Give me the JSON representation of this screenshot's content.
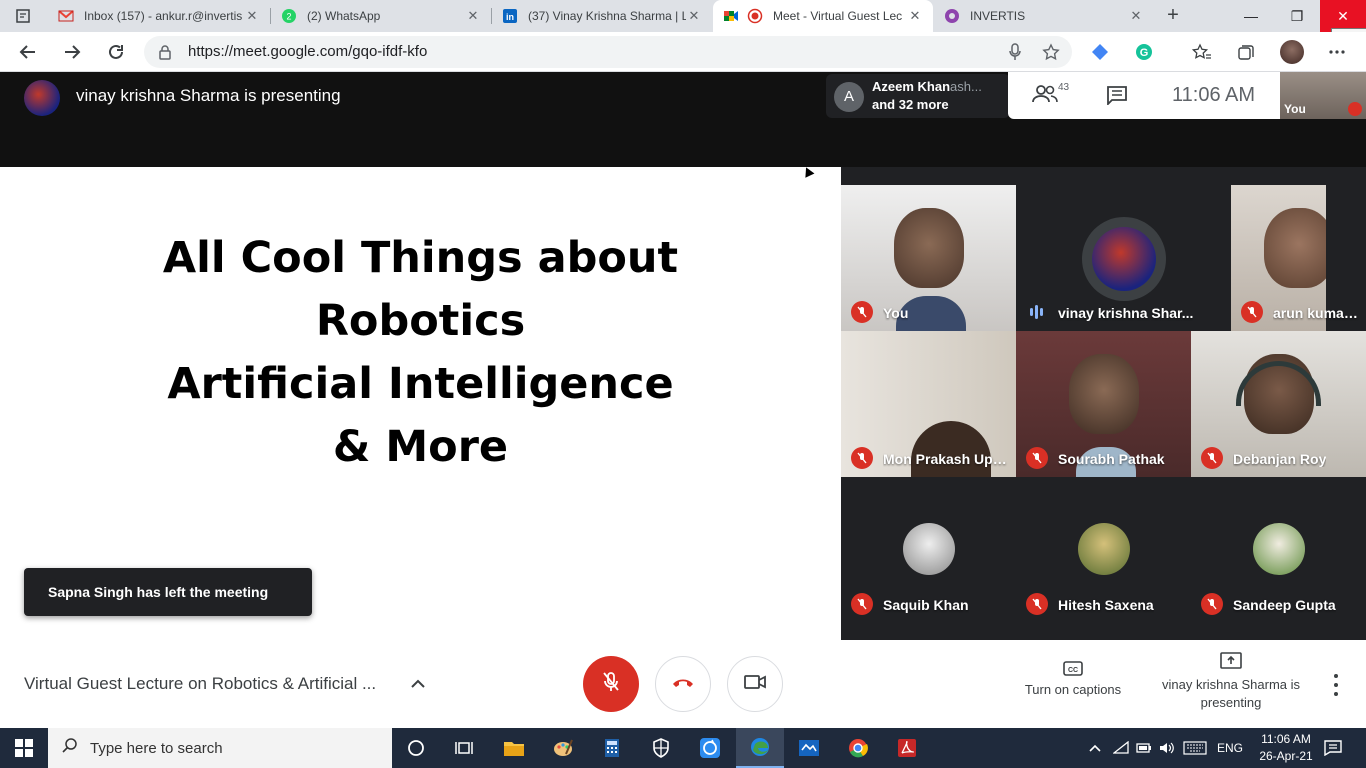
{
  "browser": {
    "tabs": [
      {
        "title": "Inbox (157) - ankur.r@invertis",
        "icon": "gmail-icon"
      },
      {
        "title": "(2) WhatsApp",
        "icon": "whatsapp-icon"
      },
      {
        "title": "(37) Vinay Krishna Sharma | Li",
        "icon": "linkedin-icon"
      },
      {
        "title": "Meet - Virtual Guest Lec",
        "icon": "meet-icon"
      },
      {
        "title": "INVERTIS",
        "icon": "invertis-icon"
      }
    ],
    "close_tooltip": "Close",
    "url": "https://meet.google.com/gqo-ifdf-kfo"
  },
  "meet": {
    "presenting_banner": "vinay krishna Sharma is presenting",
    "joiners": {
      "avatar_letter": "A",
      "line1": "Azeem Khan",
      "line1_faded": "ash...",
      "line2": "and 32 more"
    },
    "participant_count": "43",
    "clock": "11:06  AM",
    "self_label": "You",
    "slide": {
      "lines": [
        "All Cool Things about",
        "Robotics",
        "Artificial Intelligence",
        "& More"
      ]
    },
    "toast": "Sapna Singh has left the meeting",
    "participants": [
      {
        "name": "You",
        "muted": true
      },
      {
        "name": "vinay krishna Shar...",
        "muted": false
      },
      {
        "name": "arun kumar gang...",
        "muted": true
      },
      {
        "name": "Mon Prakash Upa...",
        "muted": true
      },
      {
        "name": "Sourabh Pathak",
        "muted": true
      },
      {
        "name": "Debanjan Roy",
        "muted": true
      },
      {
        "name": "Saquib Khan",
        "muted": true
      },
      {
        "name": "Hitesh Saxena",
        "muted": true
      },
      {
        "name": "Sandeep Gupta",
        "muted": true
      }
    ],
    "meeting_name": "Virtual Guest Lecture on Robotics & Artificial ...",
    "captions_label": "Turn on captions",
    "presenting_label": "vinay krishna Sharma is presenting",
    "colors": {
      "danger": "#d93025",
      "accent": "#1a73e8"
    }
  },
  "taskbar": {
    "search_placeholder": "Type here to search",
    "language": "ENG",
    "time": "11:06 AM",
    "date": "26-Apr-21"
  }
}
